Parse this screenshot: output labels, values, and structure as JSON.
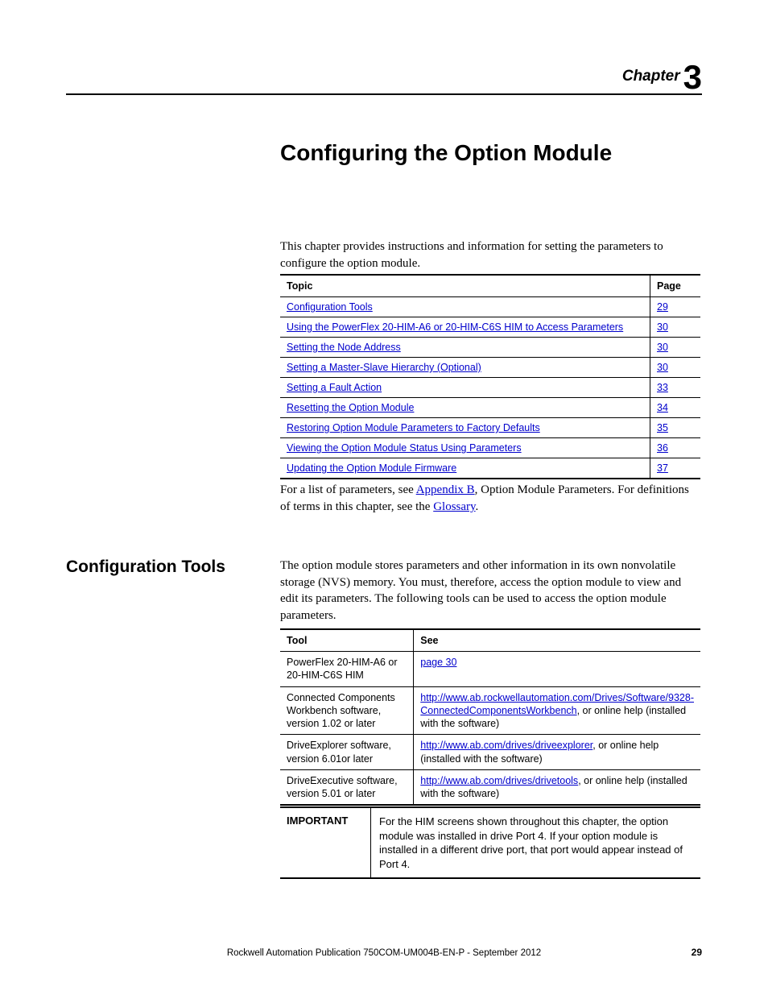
{
  "chapter": {
    "word": "Chapter",
    "number": "3"
  },
  "title": "Configuring the Option Module",
  "intro": "This chapter provides instructions and information for setting the parameters to configure the option module.",
  "toc": {
    "headers": {
      "topic": "Topic",
      "page": "Page"
    },
    "rows": [
      {
        "topic": "Configuration Tools",
        "page": "29"
      },
      {
        "topic": "Using the PowerFlex 20-HIM-A6 or 20-HIM-C6S HIM to Access Parameters",
        "page": "30"
      },
      {
        "topic": "Setting the Node Address",
        "page": "30"
      },
      {
        "topic": "Setting a Master-Slave Hierarchy (Optional)",
        "page": "30"
      },
      {
        "topic": "Setting a Fault Action",
        "page": "33"
      },
      {
        "topic": "Resetting the Option Module",
        "page": "34"
      },
      {
        "topic": "Restoring Option Module Parameters to Factory Defaults",
        "page": "35"
      },
      {
        "topic": "Viewing the Option Module Status Using Parameters",
        "page": "36"
      },
      {
        "topic": "Updating the Option Module Firmware",
        "page": "37"
      }
    ]
  },
  "after_table": {
    "prefix": "For a list of parameters, see ",
    "link1": "Appendix B",
    "mid": ", Option Module Parameters. For definitions of terms in this chapter, see the ",
    "link2": "Glossary",
    "suffix": "."
  },
  "section": {
    "heading": "Configuration Tools",
    "body": "The option module stores parameters and other information in its own nonvolatile storage (NVS) memory. You must, therefore, access the option module to view and edit its parameters. The following tools can be used to access the option module parameters."
  },
  "tool_table": {
    "headers": {
      "tool": "Tool",
      "see": "See"
    },
    "rows": [
      {
        "tool": "PowerFlex 20-HIM-A6 or 20-HIM-C6S HIM",
        "see_link": "page 30",
        "see_tail": ""
      },
      {
        "tool": "Connected Components Workbench software, version 1.02 or later",
        "see_link": "http://www.ab.rockwellautomation.com/Drives/Software/9328-ConnectedComponentsWorkbench",
        "see_tail": ", or online help (installed with the software)"
      },
      {
        "tool": "DriveExplorer software, version 6.01or later",
        "see_link": "http://www.ab.com/drives/driveexplorer",
        "see_tail": ", or online help (installed with the software)"
      },
      {
        "tool": "DriveExecutive software, version 5.01 or later",
        "see_link": "http://www.ab.com/drives/drivetools",
        "see_tail": ", or online help (installed with the software)"
      }
    ]
  },
  "important": {
    "label": "IMPORTANT",
    "text": "For the HIM screens shown throughout this chapter, the option module was installed in drive Port 4. If your option module is installed in a different drive port, that port would appear instead of Port 4."
  },
  "footer": {
    "publication": "Rockwell Automation Publication 750COM-UM004B-EN-P - September 2012",
    "page_number": "29"
  }
}
